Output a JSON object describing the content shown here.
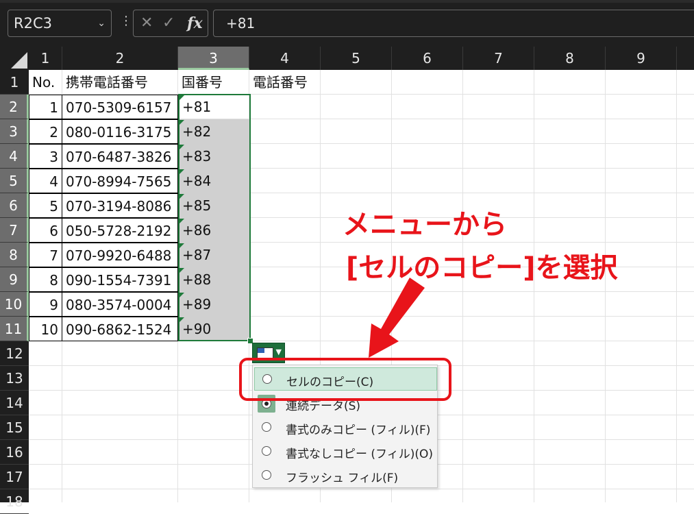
{
  "toolbar": {
    "name_box": "R2C3",
    "cancel_icon": "✕",
    "enter_icon": "✓",
    "fx_label": "fx",
    "formula": "+81"
  },
  "columns": [
    "1",
    "2",
    "3",
    "4",
    "5",
    "6",
    "7",
    "8",
    "9"
  ],
  "rows": [
    "1",
    "2",
    "3",
    "4",
    "5",
    "6",
    "7",
    "8",
    "9",
    "10",
    "11",
    "12",
    "13",
    "14",
    "15",
    "16",
    "17",
    "18"
  ],
  "table": {
    "headers": [
      "No.",
      "携帯電話番号",
      "国番号",
      "電話番号"
    ],
    "rows": [
      {
        "no": "1",
        "phone": "070-5309-6157",
        "code": "+81"
      },
      {
        "no": "2",
        "phone": "080-0116-3175",
        "code": "+82"
      },
      {
        "no": "3",
        "phone": "070-6487-3826",
        "code": "+83"
      },
      {
        "no": "4",
        "phone": "070-8994-7565",
        "code": "+84"
      },
      {
        "no": "5",
        "phone": "070-3194-8086",
        "code": "+85"
      },
      {
        "no": "6",
        "phone": "050-5728-2192",
        "code": "+86"
      },
      {
        "no": "7",
        "phone": "070-9920-6488",
        "code": "+87"
      },
      {
        "no": "8",
        "phone": "090-1554-7391",
        "code": "+88"
      },
      {
        "no": "9",
        "phone": "080-3574-0004",
        "code": "+89"
      },
      {
        "no": "10",
        "phone": "090-6862-1524",
        "code": "+90"
      }
    ]
  },
  "autofill_menu": {
    "items": [
      {
        "label": "セルのコピー(C)",
        "checked": false,
        "highlighted": true
      },
      {
        "label": "連続データ(S)",
        "checked": true,
        "highlighted": false
      },
      {
        "label": "書式のみコピー (フィル)(F)",
        "checked": false,
        "highlighted": false
      },
      {
        "label": "書式なしコピー (フィル)(O)",
        "checked": false,
        "highlighted": false
      },
      {
        "label": "フラッシュ フィル(F)",
        "checked": false,
        "highlighted": false
      }
    ]
  },
  "annotation": {
    "line1": "メニューから",
    "line2": "[セルのコピー]を選択",
    "color": "#e8141a"
  },
  "colors": {
    "selection_border": "#1e7a3a",
    "header_bg": "#1f1f1f",
    "selected_header_bg": "#6d6d6d"
  }
}
